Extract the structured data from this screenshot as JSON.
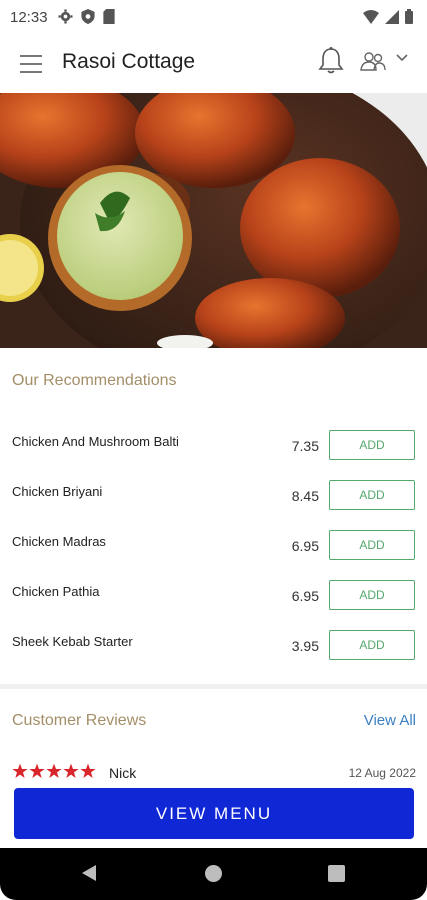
{
  "status_bar": {
    "time": "12:33"
  },
  "app_bar": {
    "title": "Rasoi Cottage"
  },
  "recommendations": {
    "title": "Our Recommendations",
    "add_label": "ADD",
    "items": [
      {
        "name": "Chicken And Mushroom Balti",
        "price": "7.35"
      },
      {
        "name": "Chicken Briyani",
        "price": "8.45"
      },
      {
        "name": "Chicken Madras",
        "price": "6.95"
      },
      {
        "name": "Chicken Pathia",
        "price": "6.95"
      },
      {
        "name": "Sheek Kebab Starter",
        "price": "3.95"
      }
    ]
  },
  "reviews": {
    "title": "Customer Reviews",
    "view_all": "View All",
    "first": {
      "name": "Nick",
      "date": "12 Aug 2022",
      "rating": 5
    }
  },
  "view_menu": "VIEW MENU",
  "colors": {
    "accent_blue": "#1027d6",
    "add_green": "#54a86b",
    "section_gold": "#a38e68",
    "link_blue": "#3b7fc4",
    "star_red": "#d9262c"
  }
}
